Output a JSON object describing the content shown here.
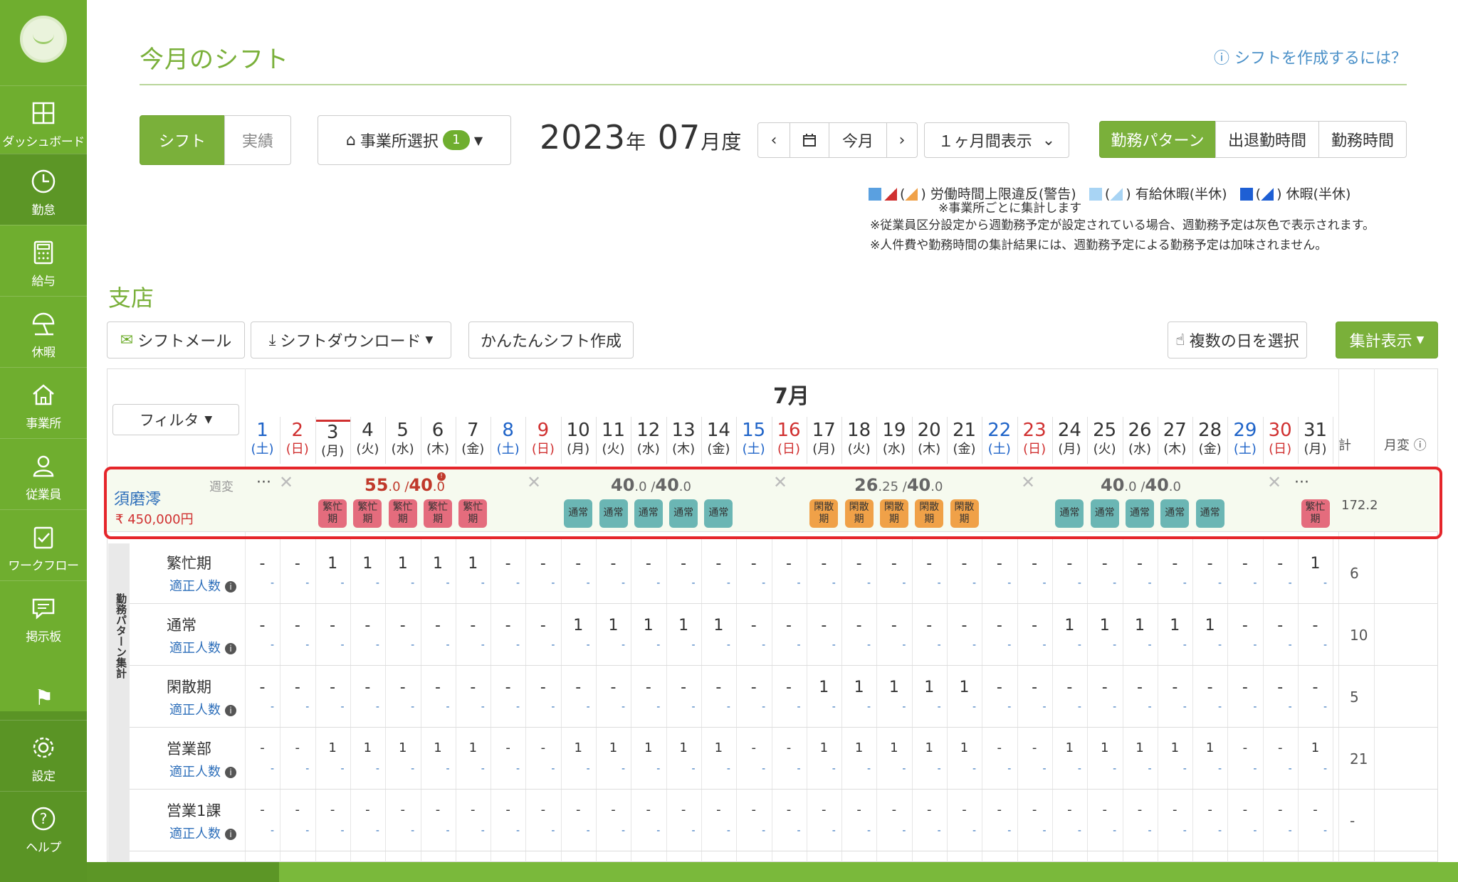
{
  "sidebar": {
    "items": [
      {
        "label": "ダッシュボード",
        "icon": "dashboard-icon"
      },
      {
        "label": "勤怠",
        "icon": "clock-icon"
      },
      {
        "label": "給与",
        "icon": "calculator-icon"
      },
      {
        "label": "休暇",
        "icon": "beach-umbrella-icon"
      },
      {
        "label": "事業所",
        "icon": "home-icon"
      },
      {
        "label": "従業員",
        "icon": "user-icon"
      },
      {
        "label": "ワークフロー",
        "icon": "clipboard-check-icon"
      },
      {
        "label": "掲示板",
        "icon": "chat-icon"
      },
      {
        "label": "設定",
        "icon": "gear-icon"
      },
      {
        "label": "ヘルプ",
        "icon": "question-icon"
      }
    ]
  },
  "header": {
    "title": "今月のシフト",
    "help_link": "シフトを作成するには？"
  },
  "toolbar": {
    "shift_tab": "シフト",
    "actual_tab": "実績",
    "office_select": "事業所選択",
    "office_count": "1",
    "year": "2023",
    "year_suffix": "年",
    "month": "07",
    "month_suffix": "月度",
    "today": "今月",
    "period": "１ヶ月間表示",
    "view_pattern": "勤務パターン",
    "view_inout": "出退勤時間",
    "view_hours": "勤務時間"
  },
  "legend": {
    "violation": "労働時間上限違反(警告)",
    "violation_note": "※事業所ごとに集計します",
    "paid_leave": "有給休暇(半休)",
    "leave": "休暇(半休)",
    "note1": "※従業員区分設定から週勤務予定が設定されている場合、週勤務予定は灰色で表示されます。",
    "note2": "※人件費や勤務時間の集計結果には、週勤務予定による勤務予定は加味されません。"
  },
  "section": {
    "title": "支店",
    "mail_btn": "シフトメール",
    "download_btn": "シフトダウンロード",
    "easy_btn": "かんたんシフト作成",
    "multi_btn": "複数の日を選択",
    "agg_btn": "集計表示"
  },
  "grid": {
    "month": "7月",
    "filter": "フィルタ",
    "total_header": "計",
    "monthly_var_header": "月変",
    "days": [
      {
        "d": "1",
        "w": "(土)",
        "t": "sat"
      },
      {
        "d": "2",
        "w": "(日)",
        "t": "sun"
      },
      {
        "d": "3",
        "w": "(月)",
        "t": "today"
      },
      {
        "d": "4",
        "w": "(火)",
        "t": ""
      },
      {
        "d": "5",
        "w": "(水)",
        "t": ""
      },
      {
        "d": "6",
        "w": "(木)",
        "t": ""
      },
      {
        "d": "7",
        "w": "(金)",
        "t": ""
      },
      {
        "d": "8",
        "w": "(土)",
        "t": "sat"
      },
      {
        "d": "9",
        "w": "(日)",
        "t": "sun"
      },
      {
        "d": "10",
        "w": "(月)",
        "t": ""
      },
      {
        "d": "11",
        "w": "(火)",
        "t": ""
      },
      {
        "d": "12",
        "w": "(水)",
        "t": ""
      },
      {
        "d": "13",
        "w": "(木)",
        "t": ""
      },
      {
        "d": "14",
        "w": "(金)",
        "t": ""
      },
      {
        "d": "15",
        "w": "(土)",
        "t": "sat"
      },
      {
        "d": "16",
        "w": "(日)",
        "t": "sun"
      },
      {
        "d": "17",
        "w": "(月)",
        "t": ""
      },
      {
        "d": "18",
        "w": "(火)",
        "t": ""
      },
      {
        "d": "19",
        "w": "(水)",
        "t": ""
      },
      {
        "d": "20",
        "w": "(木)",
        "t": ""
      },
      {
        "d": "21",
        "w": "(金)",
        "t": ""
      },
      {
        "d": "22",
        "w": "(土)",
        "t": "sat"
      },
      {
        "d": "23",
        "w": "(日)",
        "t": "sun"
      },
      {
        "d": "24",
        "w": "(月)",
        "t": ""
      },
      {
        "d": "25",
        "w": "(火)",
        "t": ""
      },
      {
        "d": "26",
        "w": "(水)",
        "t": ""
      },
      {
        "d": "27",
        "w": "(木)",
        "t": ""
      },
      {
        "d": "28",
        "w": "(金)",
        "t": ""
      },
      {
        "d": "29",
        "w": "(土)",
        "t": "sat"
      },
      {
        "d": "30",
        "w": "(日)",
        "t": "sun"
      },
      {
        "d": "31",
        "w": "(月)",
        "t": ""
      }
    ],
    "employee": {
      "name": "須磨澪",
      "week_var": "週変",
      "salary": "450,000円",
      "total": "172.2",
      "weeks": [
        {
          "main": "55",
          "dec": ".0",
          "sep": " /",
          "target": "40",
          "tdec": ".0",
          "over": true
        },
        {
          "main": "40",
          "dec": ".0",
          "sep": " /",
          "target": "40",
          "tdec": ".0",
          "over": false
        },
        {
          "main": "26",
          "dec": ".25",
          "sep": " /",
          "target": "40",
          "tdec": ".0",
          "over": false
        },
        {
          "main": "40",
          "dec": ".0",
          "sep": " /",
          "target": "40",
          "tdec": ".0",
          "over": false
        }
      ],
      "shifts": {
        "3": "busy",
        "4": "busy",
        "5": "busy",
        "6": "busy",
        "7": "busy",
        "10": "normal",
        "11": "normal",
        "12": "normal",
        "13": "normal",
        "14": "normal",
        "17": "slow",
        "18": "slow",
        "19": "slow",
        "20": "slow",
        "21": "slow",
        "24": "normal",
        "25": "normal",
        "26": "normal",
        "27": "normal",
        "28": "normal",
        "31": "busy"
      },
      "shift_labels": {
        "busy": [
          "繁忙",
          "期"
        ],
        "normal": [
          "通常",
          ""
        ],
        "slow": [
          "閑散",
          "期"
        ]
      }
    },
    "summary_label": "勤務パターン集計",
    "summary_rows": [
      {
        "name": "繁忙期",
        "sub": "適正人数",
        "total": "6",
        "ones": [
          3,
          4,
          5,
          6,
          7,
          31
        ],
        "small": false
      },
      {
        "name": "通常",
        "sub": "適正人数",
        "total": "10",
        "ones": [
          10,
          11,
          12,
          13,
          14,
          24,
          25,
          26,
          27,
          28
        ],
        "small": false
      },
      {
        "name": "閑散期",
        "sub": "適正人数",
        "total": "5",
        "ones": [
          17,
          18,
          19,
          20,
          21
        ],
        "small": false
      },
      {
        "name": "営業部",
        "sub": "適正人数",
        "total": "21",
        "ones": [
          3,
          4,
          5,
          6,
          7,
          10,
          11,
          12,
          13,
          14,
          17,
          18,
          19,
          20,
          21,
          24,
          25,
          26,
          27,
          28,
          31
        ],
        "small": true
      },
      {
        "name": "営業1課",
        "sub": "適正人数",
        "total": "-",
        "ones": [],
        "small": true
      }
    ],
    "dash": "-",
    "one": "1"
  }
}
